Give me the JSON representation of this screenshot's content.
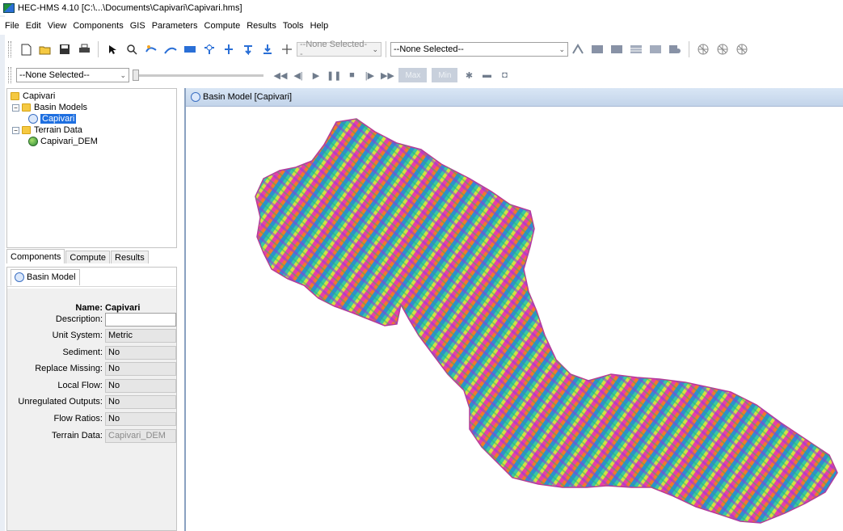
{
  "window": {
    "title": "HEC-HMS 4.10 [C:\\...\\Documents\\Capivari\\Capivari.hms]"
  },
  "menu": [
    "File",
    "Edit",
    "View",
    "Components",
    "GIS",
    "Parameters",
    "Compute",
    "Results",
    "Tools",
    "Help"
  ],
  "toolbar": {
    "component_combo": "--None Selected--",
    "run_combo": "--None Selected--",
    "time_combo": "--None Selected--",
    "max_label": "Max",
    "min_label": "Min"
  },
  "tree": {
    "root": "Capivari",
    "basin_models_label": "Basin Models",
    "basin_item": "Capivari",
    "terrain_label": "Terrain Data",
    "terrain_item": "Capivari_DEM"
  },
  "tabs": [
    "Components",
    "Compute",
    "Results"
  ],
  "properties": {
    "tab_label": "Basin Model",
    "rows": [
      {
        "label": "Name:",
        "value": "Capivari"
      },
      {
        "label": "Description:",
        "value": ""
      },
      {
        "label": "Unit System:",
        "value": "Metric"
      },
      {
        "label": "Sediment:",
        "value": "No"
      },
      {
        "label": "Replace Missing:",
        "value": "No"
      },
      {
        "label": "Local Flow:",
        "value": "No"
      },
      {
        "label": "Unregulated Outputs:",
        "value": "No"
      },
      {
        "label": "Flow Ratios:",
        "value": "No"
      },
      {
        "label": "Terrain Data:",
        "value": "Capivari_DEM"
      }
    ]
  },
  "map": {
    "title": "Basin Model [Capivari]"
  }
}
